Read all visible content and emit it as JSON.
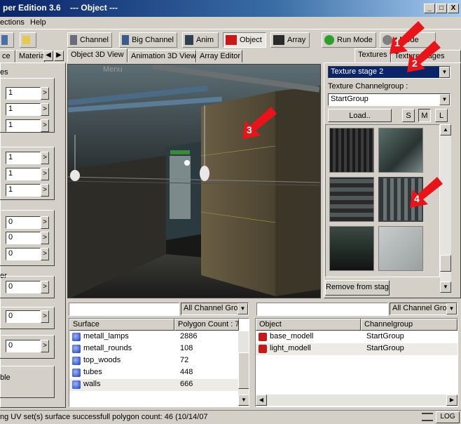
{
  "window": {
    "title_fragment": "per Edition 3.6",
    "title_context": "---  Object  ---",
    "minimize": "_",
    "maximize": "□",
    "close": "X"
  },
  "menu": {
    "items": [
      "ections",
      "Help"
    ]
  },
  "toolbar": {
    "buttons": [
      {
        "label": "Channel"
      },
      {
        "label": "Big Channel"
      },
      {
        "label": "Anim"
      },
      {
        "label": "Object"
      },
      {
        "label": "Array"
      },
      {
        "label": "Run Mode"
      },
      {
        "label": "t Mode"
      }
    ]
  },
  "left_panel": {
    "tabs": [
      "ce",
      "Materia"
    ],
    "group_caption": "es",
    "values": [
      "1",
      "1",
      "1",
      "1",
      "1",
      "1",
      "0",
      "0",
      "0",
      "0",
      "0",
      "0"
    ],
    "caption_er": "er",
    "caption_ble": "ble",
    "btn": ">"
  },
  "view_tabs": [
    "Object 3D View",
    "Animation 3D View",
    "Array Editor"
  ],
  "viewport": {
    "menu_label": "Menu"
  },
  "right_panel": {
    "tabs": [
      "Textures",
      "Texture stages"
    ],
    "stage_select": "Texture stage 2",
    "channelgroup_label": "Texture Channelgroup :",
    "channelgroup_value": "StartGroup",
    "load_button": "Load..",
    "size_buttons": [
      "S",
      "M",
      "L"
    ],
    "remove_button": "Remove from stage"
  },
  "surface_list": {
    "filter": "All Channel Grou",
    "columns": [
      "Surface",
      "Polygon Count : 7"
    ],
    "rows": [
      {
        "name": "metall_lamps",
        "count": "2886"
      },
      {
        "name": "metall_rounds",
        "count": "108"
      },
      {
        "name": "top_woods",
        "count": "72"
      },
      {
        "name": "tubes",
        "count": "448"
      },
      {
        "name": "walls",
        "count": "666"
      }
    ]
  },
  "object_list": {
    "filter": "All Channel Grou",
    "columns": [
      "Object",
      "Channelgroup"
    ],
    "rows": [
      {
        "name": "base_modell",
        "group": "StartGroup"
      },
      {
        "name": "light_modell",
        "group": "StartGroup"
      }
    ]
  },
  "annotations": [
    "1",
    "2",
    "3",
    "4"
  ],
  "status": {
    "text": "ng UV set(s) surface successfull polygon count: 46 (10/14/07",
    "right": "LOG"
  },
  "colors": {
    "highlight": "#0a246a",
    "annotation_red": "#e8141a"
  }
}
